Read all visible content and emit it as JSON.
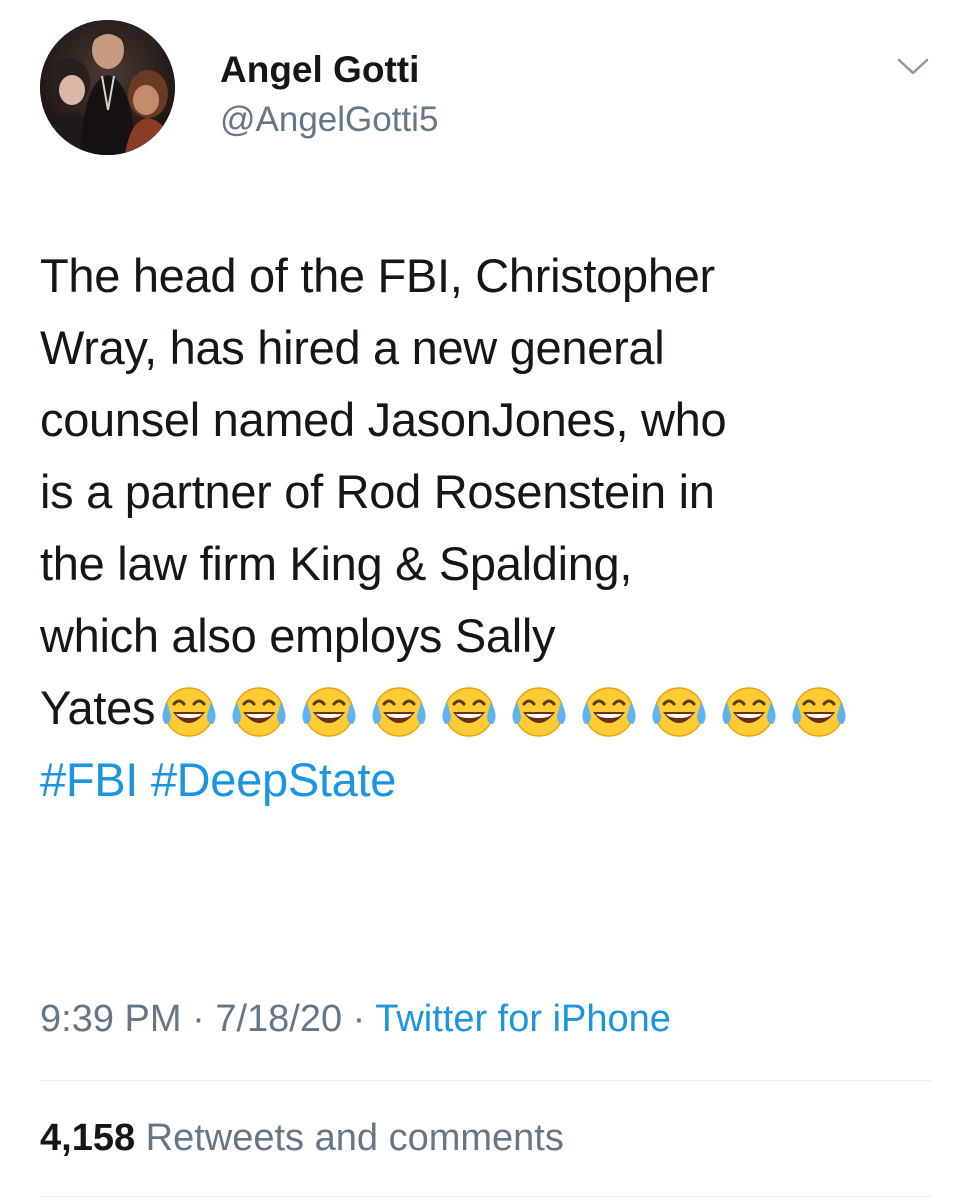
{
  "tweet": {
    "author": {
      "display_name": "Angel Gotti",
      "handle": "@AngelGotti5",
      "avatar_icon": "profile-photo"
    },
    "menu_icon": "chevron-down-icon",
    "lines": [
      "The head of the FBI, Christopher",
      "Wray, has hired a new general",
      "counsel named JasonJones, who",
      "is a partner of Rod Rosenstein in",
      "the law firm King & Spalding,",
      "which also employs Sally",
      "Yates"
    ],
    "emoji": {
      "name": "face-with-tears-of-joy",
      "count": 10
    },
    "hashtags": [
      "#FBI",
      "#DeepState"
    ],
    "meta": {
      "time": "9:39 PM",
      "separator": "·",
      "date": "7/18/20",
      "source": "Twitter for iPhone"
    },
    "stats": {
      "count": "4,158",
      "label": "Retweets and comments"
    }
  },
  "colors": {
    "text": "#14171a",
    "secondary": "#657786",
    "link": "#1b95e0",
    "divider": "#e6ecf0"
  }
}
